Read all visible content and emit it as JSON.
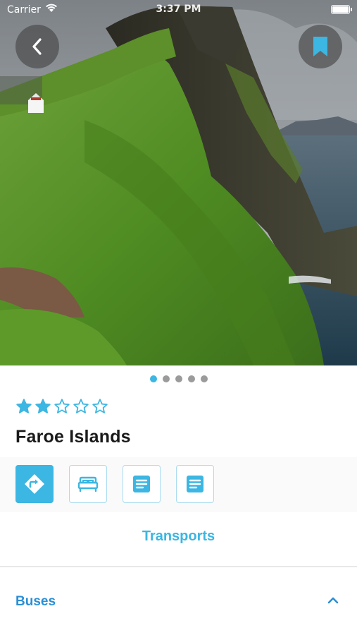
{
  "status_bar": {
    "carrier": "Carrier",
    "time": "3:37 PM"
  },
  "hero": {
    "image": "sea-cliff-lighthouse-photo"
  },
  "header": {
    "back_icon": "chevron-left-icon",
    "bookmark_icon": "bookmark-icon"
  },
  "carousel": {
    "page_count": 5,
    "current_page": 1
  },
  "rating": {
    "value": 2,
    "max": 5
  },
  "place": {
    "name": "Faroe Islands"
  },
  "categories": [
    {
      "icon": "directions-icon",
      "active": true
    },
    {
      "icon": "bed-icon",
      "active": false
    },
    {
      "icon": "document-icon",
      "active": false
    },
    {
      "icon": "document-icon",
      "active": false
    }
  ],
  "section": {
    "title": "Transports"
  },
  "accordion": {
    "title": "Buses",
    "icon": "chevron-up-icon",
    "expanded": true
  },
  "colors": {
    "accent": "#3cb6e2",
    "accordion_title": "#2b8fd6"
  }
}
